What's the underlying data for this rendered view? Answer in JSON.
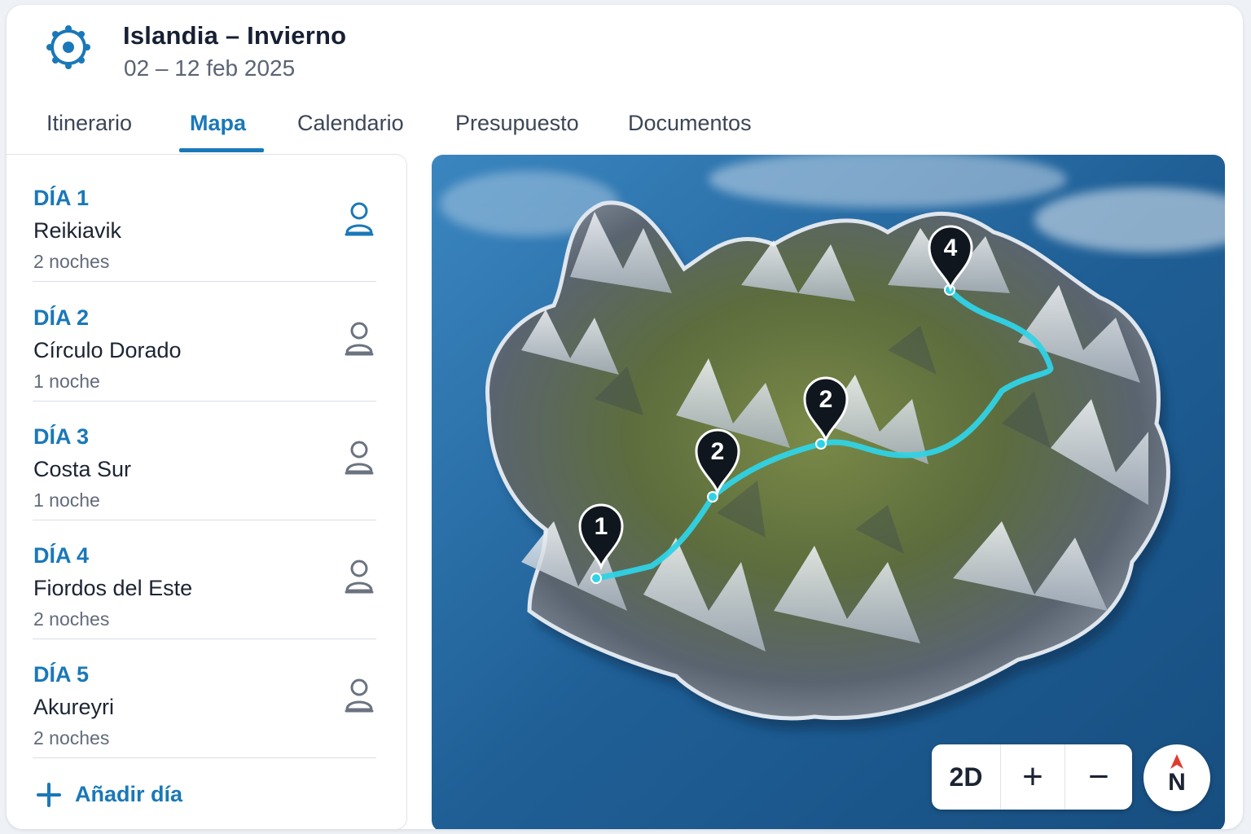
{
  "trip": {
    "title": "Islandia – Invierno",
    "dates": "02 – 12 feb 2025"
  },
  "tabs": [
    {
      "label": "Itinerario",
      "active": false
    },
    {
      "label": "Mapa",
      "active": true
    },
    {
      "label": "Calendario",
      "active": false
    },
    {
      "label": "Presupuesto",
      "active": false
    },
    {
      "label": "Documentos",
      "active": false
    }
  ],
  "days": [
    {
      "label": "DÍA 1",
      "place": "Reikiavik",
      "nights": "2 noches",
      "icon": "person-icon"
    },
    {
      "label": "DÍA 2",
      "place": "Círculo Dorado",
      "nights": "1 noche",
      "icon": "person-icon"
    },
    {
      "label": "DÍA 3",
      "place": "Costa Sur",
      "nights": "1 noche",
      "icon": "person-icon"
    },
    {
      "label": "DÍA 4",
      "place": "Fiordos del Este",
      "nights": "2 noches",
      "icon": "person-icon"
    },
    {
      "label": "DÍA 5",
      "place": "Akureyri",
      "nights": "2 noches",
      "icon": "person-icon"
    }
  ],
  "add_day": {
    "label": "Añadir día",
    "icon": "plus-icon"
  },
  "map": {
    "markers": [
      "1",
      "2",
      "2",
      "4"
    ],
    "controls": {
      "view_mode": "2D",
      "zoom_in": "+",
      "zoom_out": "−"
    },
    "compass": {
      "label": "N"
    },
    "colors": {
      "route": "#2fd3e6",
      "ocean": "#1f5f96",
      "marker": "#10161e",
      "accent": "#1a78b8"
    }
  }
}
